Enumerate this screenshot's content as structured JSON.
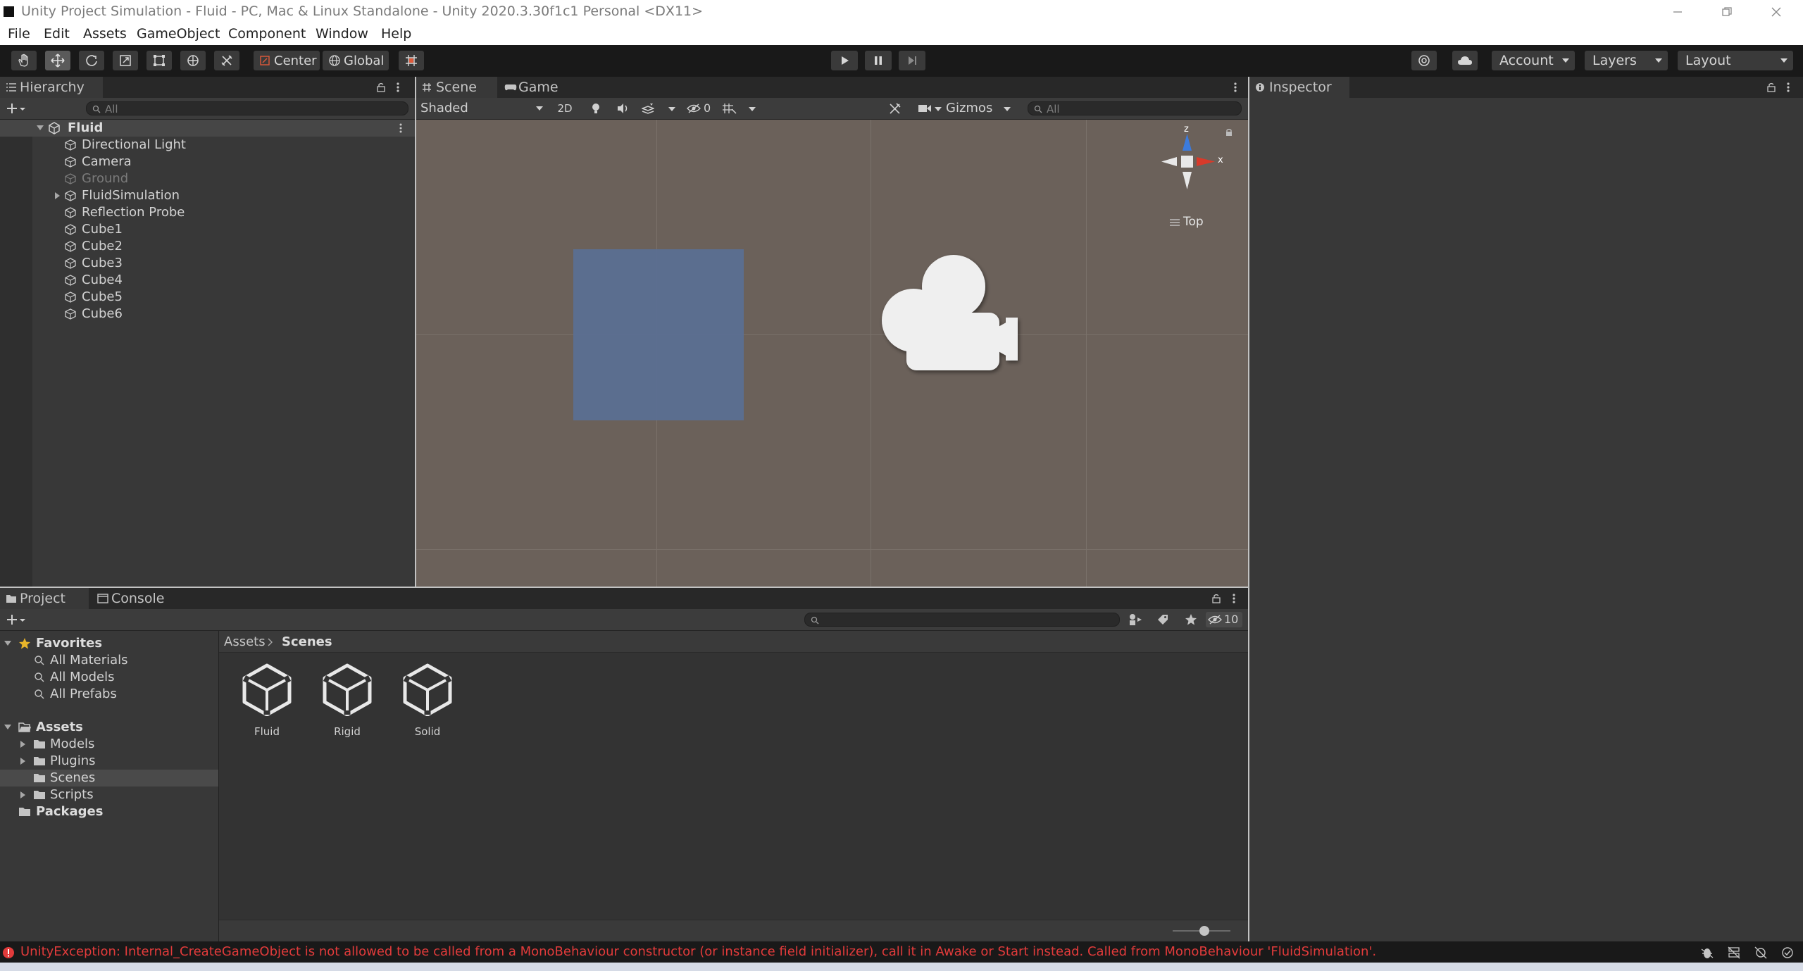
{
  "window": {
    "title": "Unity Project Simulation - Fluid - PC, Mac & Linux Standalone - Unity 2020.3.30f1c1 Personal <DX11>"
  },
  "menu": [
    "File",
    "Edit",
    "Assets",
    "GameObject",
    "Component",
    "Window",
    "Help"
  ],
  "toolbar": {
    "tools": [
      "hand-tool",
      "move-tool",
      "rotate-tool",
      "scale-tool",
      "rect-tool",
      "transform-tool",
      "custom-tool"
    ],
    "active_tool": "move-tool",
    "pivot_mode": "Center",
    "pivot_rotation": "Global",
    "account_label": "Account",
    "layers_label": "Layers",
    "layout_label": "Layout"
  },
  "hierarchy": {
    "tab_label": "Hierarchy",
    "search_placeholder": "All",
    "scene_name": "Fluid",
    "items": [
      {
        "label": "Directional Light",
        "expandable": false,
        "disabled": false
      },
      {
        "label": "Camera",
        "expandable": false,
        "disabled": false
      },
      {
        "label": "Ground",
        "expandable": false,
        "disabled": true
      },
      {
        "label": "FluidSimulation",
        "expandable": true,
        "disabled": false
      },
      {
        "label": "Reflection Probe",
        "expandable": false,
        "disabled": false
      },
      {
        "label": "Cube1",
        "expandable": false,
        "disabled": false
      },
      {
        "label": "Cube2",
        "expandable": false,
        "disabled": false
      },
      {
        "label": "Cube3",
        "expandable": false,
        "disabled": false
      },
      {
        "label": "Cube4",
        "expandable": false,
        "disabled": false
      },
      {
        "label": "Cube5",
        "expandable": false,
        "disabled": false
      },
      {
        "label": "Cube6",
        "expandable": false,
        "disabled": false
      }
    ]
  },
  "scene_view": {
    "tabs": [
      "Scene",
      "Game"
    ],
    "active_tab": "Scene",
    "draw_mode": "Shaded",
    "mode_2d_label": "2D",
    "hidden_count": "0",
    "gizmos_label": "Gizmos",
    "search_placeholder": "All",
    "orientation_label": "Top",
    "axis_x": "x",
    "axis_z": "z",
    "colors": {
      "background": "#6b615a",
      "cube": "#5b6e92"
    }
  },
  "inspector": {
    "tab_label": "Inspector"
  },
  "project": {
    "tabs": [
      "Project",
      "Console"
    ],
    "active_tab": "Project",
    "favorites_label": "Favorites",
    "favorites": [
      "All Materials",
      "All Models",
      "All Prefabs"
    ],
    "assets_label": "Assets",
    "assets": [
      {
        "label": "Models",
        "expandable": true
      },
      {
        "label": "Plugins",
        "expandable": true
      },
      {
        "label": "Scenes",
        "expandable": false,
        "selected": true
      },
      {
        "label": "Scripts",
        "expandable": true
      }
    ],
    "packages_label": "Packages",
    "breadcrumb": [
      "Assets",
      "Scenes"
    ],
    "files": [
      "Fluid",
      "Rigid",
      "Solid"
    ],
    "hidden_packages_count": "10",
    "zoom_slider": 0.55
  },
  "statusbar": {
    "message": "UnityException: Internal_CreateGameObject is not allowed to be called from a MonoBehaviour constructor (or instance field initializer), call it in Awake or Start instead. Called from MonoBehaviour 'FluidSimulation'.",
    "error_color": "#e23b3b"
  }
}
